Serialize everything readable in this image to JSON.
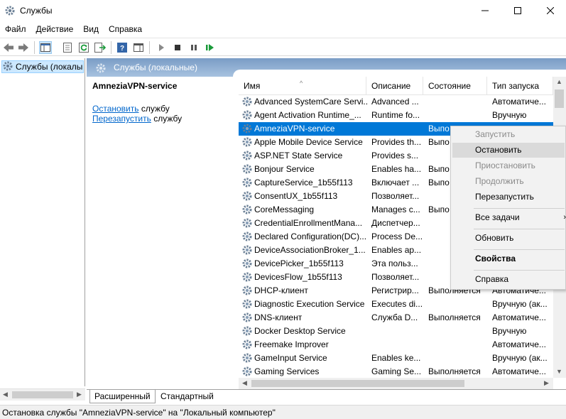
{
  "window": {
    "title": "Службы"
  },
  "menu": [
    {
      "label": "Файл"
    },
    {
      "label": "Действие"
    },
    {
      "label": "Вид"
    },
    {
      "label": "Справка"
    }
  ],
  "toolbar_icons": [
    "back-arrow",
    "forward-arrow",
    "console-tree",
    "properties",
    "refresh",
    "export-list",
    "help",
    "show-hide-pane",
    "start",
    "stop",
    "pause",
    "restart"
  ],
  "left_tree": {
    "root_label": "Службы (локалы"
  },
  "header": {
    "title": "Службы (локальные)"
  },
  "ext_panel": {
    "service_name": "AmneziaVPN-service",
    "stop_link": "Остановить",
    "stop_suffix": " службу",
    "restart_link": "Перезапустить",
    "restart_suffix": " службу"
  },
  "columns": {
    "name": "Имя",
    "desc": "Описание",
    "state": "Состояние",
    "start": "Тип запуска"
  },
  "services": [
    {
      "name": "Advanced SystemCare Servi...",
      "desc": "Advanced ...",
      "state": "",
      "start": "Автоматиче..."
    },
    {
      "name": "Agent Activation Runtime_...",
      "desc": "Runtime fo...",
      "state": "",
      "start": "Вручную"
    },
    {
      "name": "AmneziaVPN-service",
      "desc": "",
      "state": "Выпо",
      "start": "",
      "selected": true
    },
    {
      "name": "Apple Mobile Device Service",
      "desc": "Provides th...",
      "state": "Выпо",
      "start": ""
    },
    {
      "name": "ASP.NET State Service",
      "desc": "Provides s...",
      "state": "",
      "start": ""
    },
    {
      "name": "Bonjour Service",
      "desc": "Enables ha...",
      "state": "Выпо",
      "start": ""
    },
    {
      "name": "CaptureService_1b55f113",
      "desc": "Включает ...",
      "state": "Выпо",
      "start": ""
    },
    {
      "name": "ConsentUX_1b55f113",
      "desc": "Позволяет...",
      "state": "",
      "start": ""
    },
    {
      "name": "CoreMessaging",
      "desc": "Manages c...",
      "state": "Выпо",
      "start": ""
    },
    {
      "name": "CredentialEnrollmentMana...",
      "desc": "Диспетчер...",
      "state": "",
      "start": ""
    },
    {
      "name": "Declared Configuration(DC)...",
      "desc": "Process De...",
      "state": "",
      "start": ""
    },
    {
      "name": "DeviceAssociationBroker_1...",
      "desc": "Enables ap...",
      "state": "",
      "start": ""
    },
    {
      "name": "DevicePicker_1b55f113",
      "desc": "Эта польз...",
      "state": "",
      "start": ""
    },
    {
      "name": "DevicesFlow_1b55f113",
      "desc": "Позволяет...",
      "state": "",
      "start": ""
    },
    {
      "name": "DHCP-клиент",
      "desc": "Регистрир...",
      "state": "Выполняется",
      "start": "Автоматиче..."
    },
    {
      "name": "Diagnostic Execution Service",
      "desc": "Executes di...",
      "state": "",
      "start": "Вручную (ак..."
    },
    {
      "name": "DNS-клиент",
      "desc": "Служба D...",
      "state": "Выполняется",
      "start": "Автоматиче..."
    },
    {
      "name": "Docker Desktop Service",
      "desc": "",
      "state": "",
      "start": "Вручную"
    },
    {
      "name": "Freemake Improver",
      "desc": "",
      "state": "",
      "start": "Автоматиче..."
    },
    {
      "name": "GameInput Service",
      "desc": "Enables ke...",
      "state": "",
      "start": "Вручную (ак..."
    },
    {
      "name": "Gaming Services",
      "desc": "Gaming Se...",
      "state": "Выполняется",
      "start": "Автоматиче..."
    }
  ],
  "context_menu": [
    {
      "label": "Запустить",
      "disabled": true
    },
    {
      "label": "Остановить",
      "hover": true
    },
    {
      "label": "Приостановить",
      "disabled": true
    },
    {
      "label": "Продолжить",
      "disabled": true
    },
    {
      "label": "Перезапустить"
    },
    {
      "label": "Все задачи",
      "submenu": true
    },
    {
      "label": "Обновить"
    },
    {
      "label": "Свойства",
      "bold": true
    },
    {
      "label": "Справка"
    }
  ],
  "tabs": {
    "extended": "Расширенный",
    "standard": "Стандартный"
  },
  "status": {
    "text": "Остановка службы \"AmneziaVPN-service\" на \"Локальный компьютер\""
  },
  "colors": {
    "selection": "#0078d7",
    "header_band": "#7a9cc5",
    "link": "#0066cc"
  }
}
